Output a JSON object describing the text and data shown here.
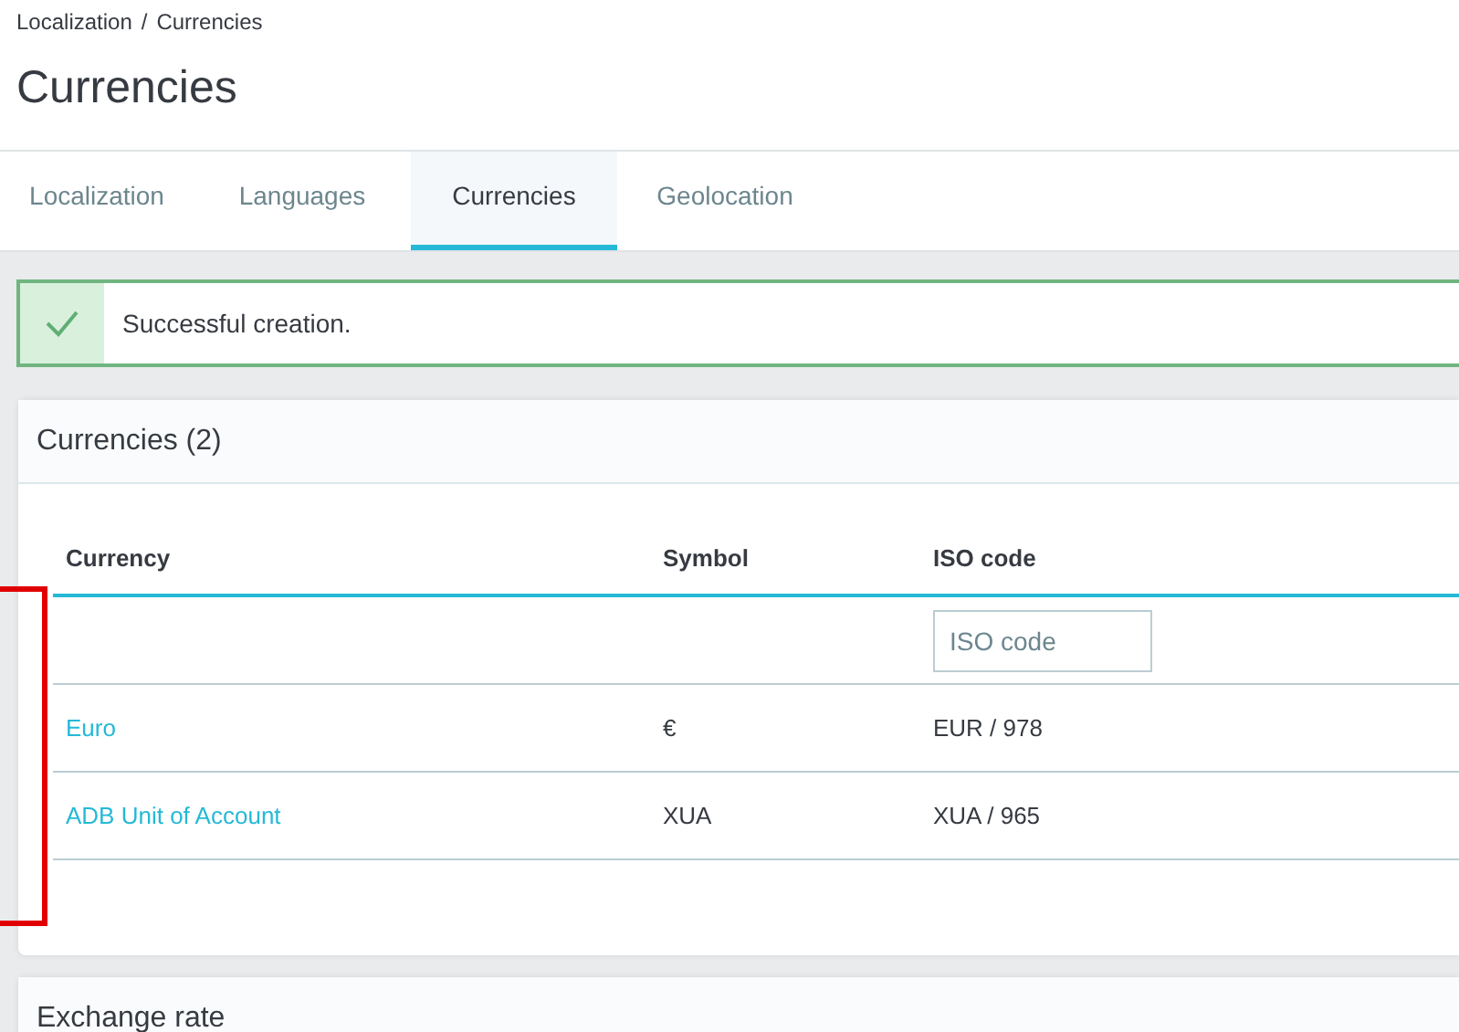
{
  "breadcrumb": {
    "items": [
      "Localization",
      "Currencies"
    ],
    "separator": "/"
  },
  "title": "Currencies",
  "tabs": [
    {
      "label": "Localization",
      "selected": false
    },
    {
      "label": "Languages",
      "selected": false
    },
    {
      "label": "Currencies",
      "selected": true
    },
    {
      "label": "Geolocation",
      "selected": false
    }
  ],
  "alert": {
    "message": "Successful creation."
  },
  "currencies_card": {
    "title": "Currencies (2)",
    "table": {
      "columns": [
        "Currency",
        "Symbol",
        "ISO code"
      ],
      "filter": {
        "placeholder": "ISO code"
      },
      "rows": [
        {
          "currency": "Euro",
          "symbol": "€",
          "iso_code": "EUR / 978"
        },
        {
          "currency": "ADB Unit of Account",
          "symbol": "XUA",
          "iso_code": "XUA / 965"
        }
      ]
    }
  },
  "exchange_card": {
    "title": "Exchange rate"
  }
}
